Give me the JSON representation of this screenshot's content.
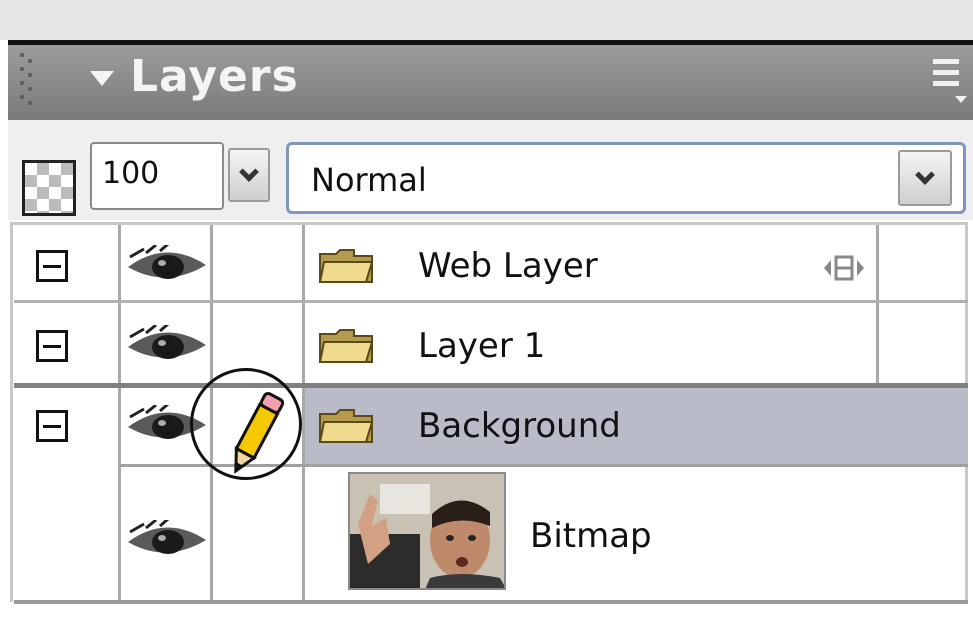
{
  "panel": {
    "title": "Layers",
    "opacity_value": "100",
    "blend_mode": "Normal"
  },
  "layers": [
    {
      "name": "Web Layer",
      "type": "folder",
      "visible": true,
      "editing": false,
      "selected": false
    },
    {
      "name": "Layer 1",
      "type": "folder",
      "visible": true,
      "editing": false,
      "selected": false
    },
    {
      "name": "Background",
      "type": "folder",
      "visible": true,
      "editing": true,
      "selected": true,
      "children": [
        {
          "name": "Bitmap",
          "type": "bitmap",
          "visible": true
        }
      ]
    }
  ],
  "icons": {
    "collapse": "minus-box-icon",
    "eye": "eye-icon",
    "folder": "folder-icon",
    "pencil": "pencil-icon",
    "menu": "panel-options-icon",
    "web_ctrl": "web-layer-control-icon",
    "opacity": "checkerboard-icon"
  },
  "colors": {
    "header_bg": "#8c8c8c",
    "selected_row": "#b9bcc8",
    "folder": "#e8d089",
    "pencil": "#f2c400"
  }
}
